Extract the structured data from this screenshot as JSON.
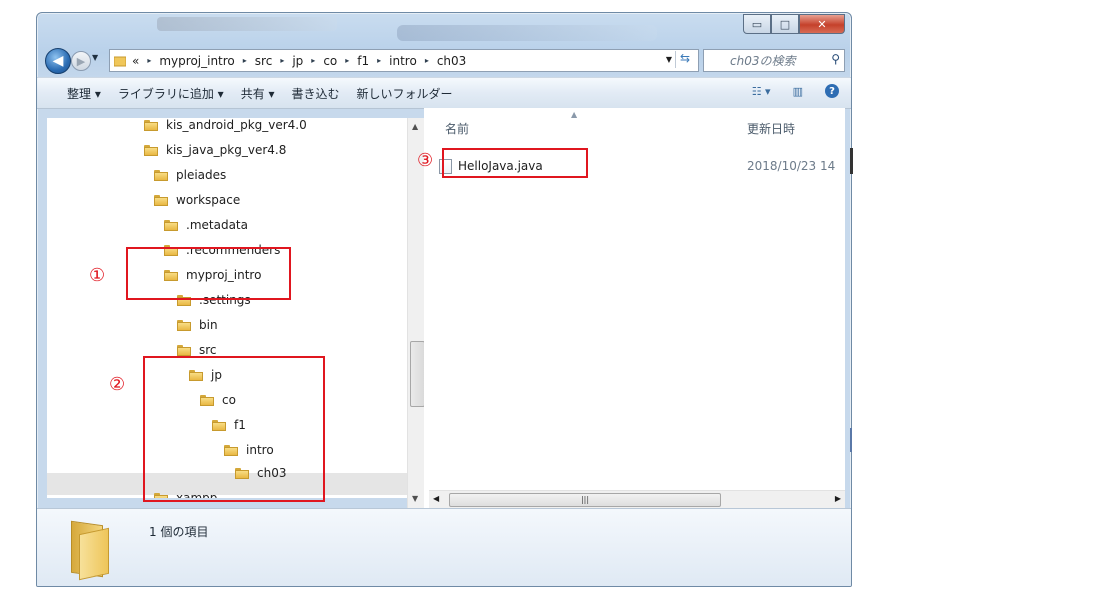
{
  "window": {
    "caption_buttons": {
      "minimize": "▭",
      "maximize": "□",
      "close": "✕"
    }
  },
  "address_bar": {
    "overflow": "«",
    "path": [
      "myproj_intro",
      "src",
      "jp",
      "co",
      "f1",
      "intro",
      "ch03"
    ],
    "search_placeholder": "ch03の検索"
  },
  "command_bar": {
    "items": [
      "整理 ▾",
      "ライブラリに追加 ▾",
      "共有 ▾",
      "書き込む",
      "新しいフォルダー"
    ]
  },
  "nav_tree": {
    "items": [
      {
        "label": "kis_android_pkg_ver4.0"
      },
      {
        "label": "kis_java_pkg_ver4.8"
      },
      {
        "label": "pleiades"
      },
      {
        "label": "workspace"
      },
      {
        "label": ".metadata"
      },
      {
        "label": ".recommenders"
      },
      {
        "label": "myproj_intro"
      },
      {
        "label": ".settings"
      },
      {
        "label": "bin"
      },
      {
        "label": "src"
      },
      {
        "label": "jp"
      },
      {
        "label": "co"
      },
      {
        "label": "f1"
      },
      {
        "label": "intro"
      },
      {
        "label": "ch03",
        "selected": true
      },
      {
        "label": "xampp"
      }
    ]
  },
  "file_list": {
    "columns": [
      "名前",
      "更新日時"
    ],
    "rows": [
      {
        "name": "HelloJava.java",
        "modified": "2018/10/23 14"
      }
    ]
  },
  "details_pane": {
    "item_count": "1 個の項目"
  },
  "annotations": {
    "marks": [
      "①",
      "②",
      "③"
    ],
    "color": "#e0161f"
  },
  "colors": {
    "window_border": "#6f8aa5",
    "selected_row": "#e5e5e5",
    "annotation": "#e0161f"
  }
}
